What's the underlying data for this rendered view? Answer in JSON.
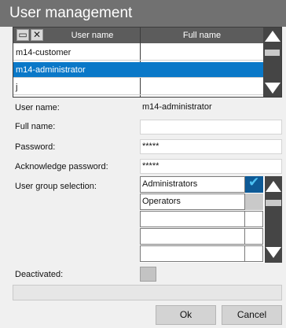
{
  "window": {
    "title": "User management"
  },
  "user_list": {
    "col_username": "User name",
    "col_fullname": "Full name",
    "toolbar": [
      {
        "icon": "new-document-icon",
        "glyph": "▭"
      },
      {
        "icon": "delete-x-icon",
        "glyph": "✕"
      }
    ],
    "rows": [
      {
        "username": "m14-customer",
        "fullname": ""
      },
      {
        "username": "m14-administrator",
        "fullname": "",
        "selected": true
      },
      {
        "username": "j",
        "fullname": ""
      }
    ]
  },
  "form": {
    "username_label": "User name:",
    "username_value": "m14-administrator",
    "fullname_label": "Full name:",
    "fullname_value": "",
    "password_label": "Password:",
    "password_value": "*****",
    "ack_password_label": "Acknowledge password:",
    "ack_password_value": "*****",
    "group_label": "User group selection:",
    "groups": [
      {
        "name": "Administrators",
        "checked": true
      },
      {
        "name": "Operators",
        "checked": false
      },
      {
        "name": "",
        "checked": false
      },
      {
        "name": "",
        "checked": false
      },
      {
        "name": "",
        "checked": false
      }
    ],
    "deactivated_label": "Deactivated:"
  },
  "buttons": {
    "ok": "Ok",
    "cancel": "Cancel"
  },
  "colors": {
    "title_bar": "#717171",
    "selection": "#0a78c8",
    "check_bg": "#0e5a96",
    "check_mark": "#4ec3f4",
    "scrollbar": "#454545"
  }
}
